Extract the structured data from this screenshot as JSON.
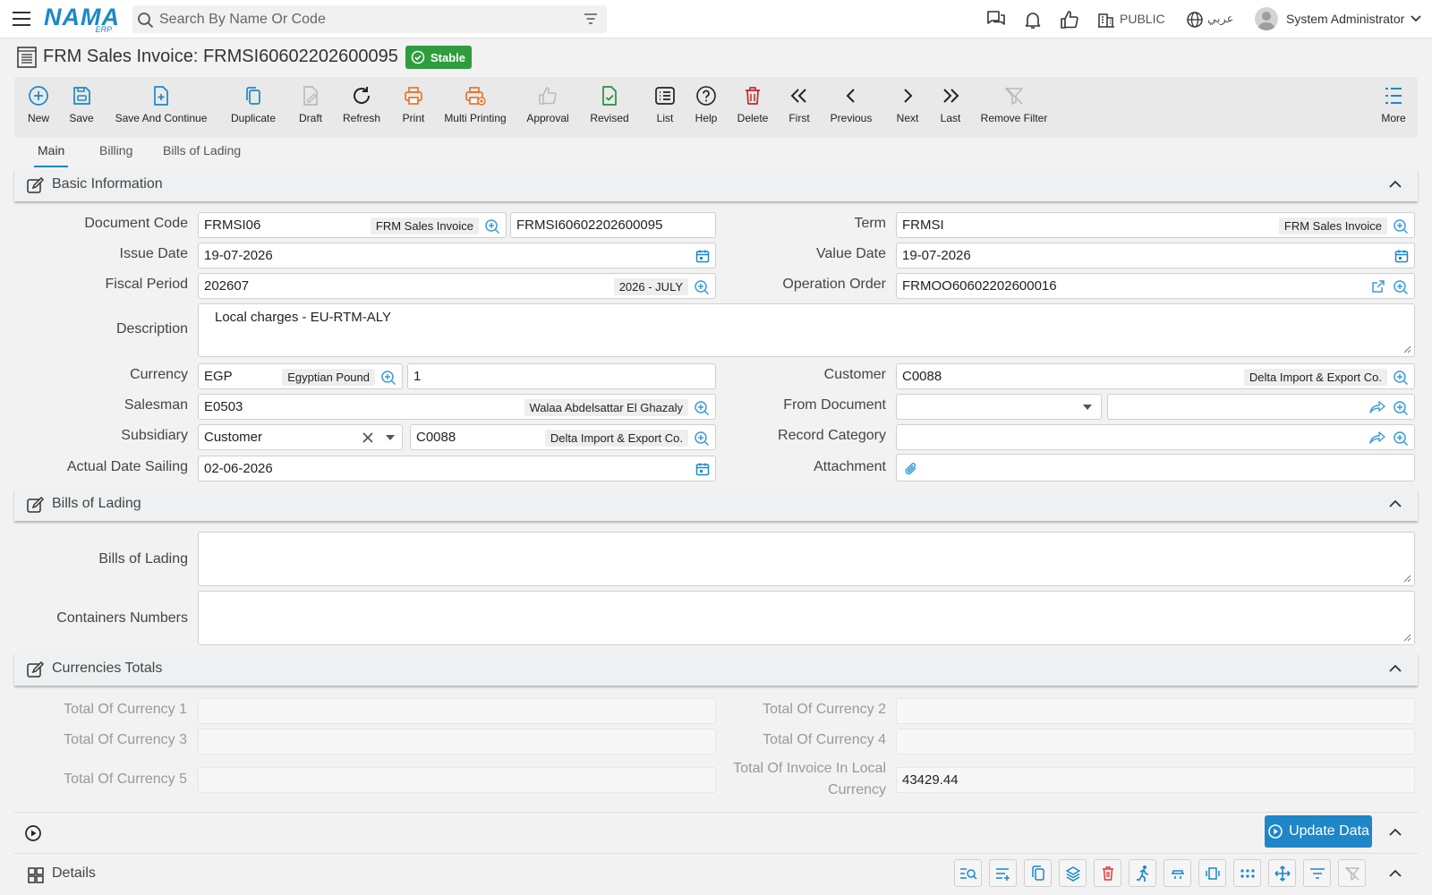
{
  "app": {
    "logo_text": "NAMA",
    "logo_sub": "ERP"
  },
  "search": {
    "placeholder": "Search By Name Or Code"
  },
  "header": {
    "public_label": "PUBLIC",
    "language_label": "عربي",
    "user_name": "System Administrator"
  },
  "page": {
    "title": "FRM Sales Invoice: FRMSI60602202600095",
    "status": "Stable"
  },
  "toolbar": {
    "new": "New",
    "save": "Save",
    "save_continue": "Save And Continue",
    "duplicate": "Duplicate",
    "draft": "Draft",
    "refresh": "Refresh",
    "print": "Print",
    "multi_printing": "Multi Printing",
    "approval": "Approval",
    "revised": "Revised",
    "list": "List",
    "help": "Help",
    "delete": "Delete",
    "first": "First",
    "previous": "Previous",
    "next": "Next",
    "last": "Last",
    "remove_filter": "Remove Filter",
    "more": "More"
  },
  "tabs": {
    "main": "Main",
    "billing": "Billing",
    "bills_of_lading": "Bills of Lading",
    "active": "Main"
  },
  "basic": {
    "title": "Basic Information",
    "document_code": {
      "label": "Document Code",
      "code": "FRMSI06",
      "tag": "FRM Sales Invoice",
      "number": "FRMSI60602202600095"
    },
    "term": {
      "label": "Term",
      "code": "FRMSI",
      "tag": "FRM Sales Invoice"
    },
    "issue_date": {
      "label": "Issue Date",
      "value": "19-07-2026"
    },
    "value_date": {
      "label": "Value Date",
      "value": "19-07-2026"
    },
    "fiscal_period": {
      "label": "Fiscal Period",
      "value": "202607",
      "tag": "2026 - JULY"
    },
    "operation_order": {
      "label": "Operation Order",
      "value": "FRMOO60602202600016"
    },
    "description": {
      "label": "Description",
      "value": "Local charges - EU-RTM-ALY"
    },
    "currency": {
      "label": "Currency",
      "code": "EGP",
      "tag": "Egyptian Pound",
      "rate": "1"
    },
    "customer": {
      "label": "Customer",
      "code": "C0088",
      "tag": "Delta Import & Export Co."
    },
    "salesman": {
      "label": "Salesman",
      "code": "E0503",
      "tag": "Walaa Abdelsattar El Ghazaly"
    },
    "from_document": {
      "label": "From Document",
      "value": "",
      "ref": ""
    },
    "subsidiary": {
      "label": "Subsidiary",
      "type": "Customer",
      "code": "C0088",
      "tag": "Delta Import & Export Co."
    },
    "record_category": {
      "label": "Record Category",
      "value": ""
    },
    "actual_date_sailing": {
      "label": "Actual Date Sailing",
      "value": "02-06-2026"
    },
    "attachment": {
      "label": "Attachment"
    }
  },
  "bol": {
    "title": "Bills of Lading",
    "bills_label": "Bills of Lading",
    "containers_label": "Containers Numbers",
    "bills_value": "",
    "containers_value": ""
  },
  "totals": {
    "title": "Currencies Totals",
    "c1": "Total Of Currency 1",
    "c2": "Total Of Currency 2",
    "c3": "Total Of Currency 3",
    "c4": "Total Of Currency 4",
    "c5": "Total Of Currency 5",
    "local_label_1": "Total Of Invoice In Local",
    "local_label_2": "Currency",
    "local_value": "43429.44"
  },
  "actions": {
    "update_data": "Update Data"
  },
  "details": {
    "title": "Details"
  },
  "colors": {
    "accent": "#1a88c9",
    "status_green": "#2e9d3e",
    "print_orange": "#e8742a",
    "delete_red": "#c62828",
    "revised_green": "#2e8b3e"
  }
}
